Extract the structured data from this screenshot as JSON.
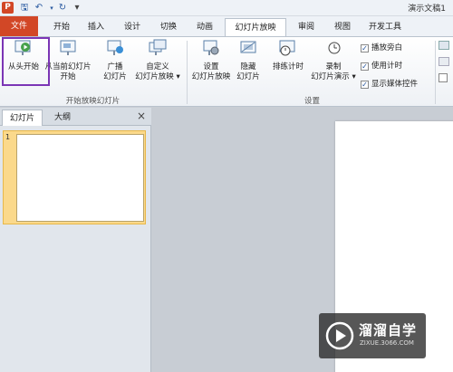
{
  "titlebar": {
    "app_icon": "P",
    "title": "演示文稿1",
    "quick_access": [
      "save-icon",
      "undo-icon",
      "redo-icon",
      "customize-icon"
    ]
  },
  "tabs": [
    "文件",
    "开始",
    "插入",
    "设计",
    "切换",
    "动画",
    "幻灯片放映",
    "审阅",
    "视图",
    "开发工具"
  ],
  "active_tab": "幻灯片放映",
  "ribbon": {
    "from_beginning": "从头开始",
    "from_current_1": "从当前幻灯片",
    "from_current_2": "开始",
    "broadcast_1": "广播",
    "broadcast_2": "幻灯片",
    "custom_1": "自定义",
    "custom_2": "幻灯片放映",
    "group_start": "开始放映幻灯片",
    "setup_1": "设置",
    "setup_2": "幻灯片放映",
    "hide_1": "隐藏",
    "hide_2": "幻灯片",
    "rehearse": "排练计时",
    "record_1": "录制",
    "record_2": "幻灯片演示",
    "play_narration": "播放旁白",
    "use_timings": "使用计时",
    "show_media_controls": "显示媒体控件",
    "group_setup": "设置"
  },
  "pane": {
    "tab_slides": "幻灯片",
    "tab_outline": "大纲",
    "close": "×",
    "slide_number": "1"
  },
  "watermark": {
    "name": "溜溜自学",
    "url": "ZIXUE.3066.COM"
  }
}
